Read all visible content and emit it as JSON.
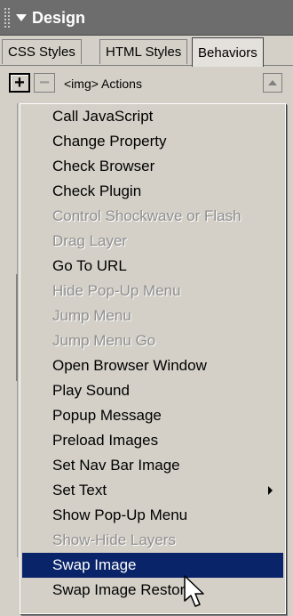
{
  "panel": {
    "title": "Design"
  },
  "tabs": [
    {
      "label": "CSS Styles",
      "active": false
    },
    {
      "label": "HTML Styles",
      "active": false
    },
    {
      "label": "Behaviors",
      "active": true
    }
  ],
  "toolbar": {
    "add_label": "+",
    "remove_label": "−",
    "context_label": "<img> Actions"
  },
  "menu": {
    "items": [
      {
        "label": "Call JavaScript",
        "state": "enabled"
      },
      {
        "label": "Change Property",
        "state": "enabled"
      },
      {
        "label": "Check Browser",
        "state": "enabled"
      },
      {
        "label": "Check Plugin",
        "state": "enabled"
      },
      {
        "label": "Control Shockwave or Flash",
        "state": "disabled"
      },
      {
        "label": "Drag Layer",
        "state": "disabled"
      },
      {
        "label": "Go To URL",
        "state": "enabled"
      },
      {
        "label": "Hide Pop-Up Menu",
        "state": "disabled"
      },
      {
        "label": "Jump Menu",
        "state": "disabled"
      },
      {
        "label": "Jump Menu Go",
        "state": "disabled"
      },
      {
        "label": "Open Browser Window",
        "state": "enabled"
      },
      {
        "label": "Play Sound",
        "state": "enabled"
      },
      {
        "label": "Popup Message",
        "state": "enabled"
      },
      {
        "label": "Preload Images",
        "state": "enabled"
      },
      {
        "label": "Set Nav Bar Image",
        "state": "enabled"
      },
      {
        "label": "Set Text",
        "state": "enabled",
        "submenu": true
      },
      {
        "label": "Show Pop-Up Menu",
        "state": "enabled"
      },
      {
        "label": "Show-Hide Layers",
        "state": "disabled"
      },
      {
        "label": "Swap Image",
        "state": "selected"
      },
      {
        "label": "Swap Image Restore",
        "state": "enabled"
      }
    ]
  },
  "colors": {
    "header": "#6d6d6d",
    "panel": "#d4d0c8",
    "selection": "#0a246a",
    "disabled_text": "#8f8f8f"
  }
}
